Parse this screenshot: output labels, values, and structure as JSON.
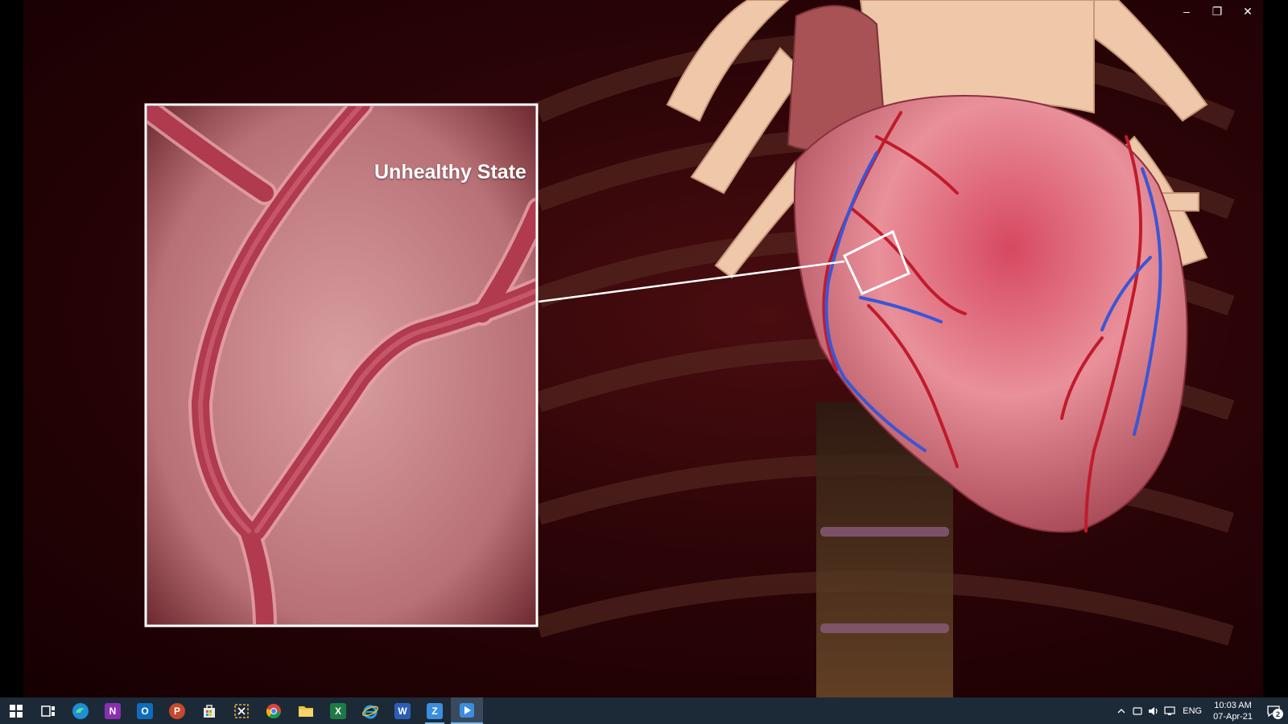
{
  "video": {
    "inset_label": "Unhealthy State"
  },
  "window_controls": {
    "minimize": "–",
    "restore": "❐",
    "close": "✕"
  },
  "taskbar": {
    "apps": [
      {
        "name": "start-icon"
      },
      {
        "name": "task-view-icon"
      },
      {
        "name": "edge-icon",
        "color": "#1f8ed6"
      },
      {
        "name": "onenote-icon",
        "glyph": "N",
        "color": "#8a2fb0"
      },
      {
        "name": "outlook-icon",
        "glyph": "O",
        "color": "#0f6cbd"
      },
      {
        "name": "powerpoint-icon",
        "glyph": "P",
        "color": "#c8482b"
      },
      {
        "name": "store-icon",
        "color": "#e9e9e9"
      },
      {
        "name": "snipping-tool-icon",
        "color": "#e8b13a"
      },
      {
        "name": "chrome-icon"
      },
      {
        "name": "file-explorer-icon",
        "color": "#f0c23a"
      },
      {
        "name": "excel-icon",
        "glyph": "X",
        "color": "#1e7a45"
      },
      {
        "name": "internet-explorer-icon",
        "color": "#2aa3e0"
      },
      {
        "name": "word-icon",
        "glyph": "W",
        "color": "#2b5eb5"
      },
      {
        "name": "zoom-icon",
        "glyph": "Z",
        "color": "#3b8ddf"
      },
      {
        "name": "media-player-icon",
        "color": "#3b8ddf"
      }
    ],
    "active_app_index": 14,
    "tray": {
      "language": "ENG",
      "time": "10:03 AM",
      "date": "07-Apr-21",
      "notification_count": "2"
    }
  }
}
